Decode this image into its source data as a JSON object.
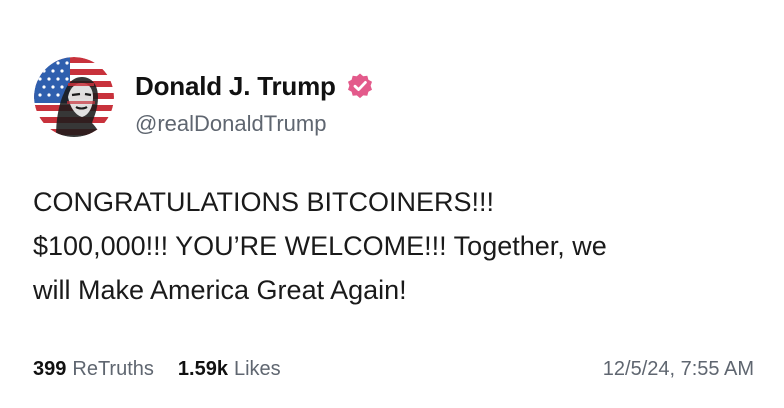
{
  "author": {
    "display_name": "Donald J. Trump",
    "handle": "@realDonaldTrump",
    "verified_icon": "verified-badge-icon",
    "avatar_icon": "avatar-flag-portrait"
  },
  "post": {
    "text": "CONGRATULATIONS BITCOINERS!!!\n$100,000!!! YOU’RE WELCOME!!! Together, we\nwill Make America Great Again!"
  },
  "stats": {
    "retruths_count": "399",
    "retruths_label": "ReTruths",
    "likes_count": "1.59k",
    "likes_label": "Likes"
  },
  "timestamp": "12/5/24, 7:55 AM",
  "colors": {
    "verified_badge": "#e35a8b",
    "secondary_text": "#5f6670",
    "flag_red": "#c8323c",
    "flag_blue": "#2f5fae"
  }
}
